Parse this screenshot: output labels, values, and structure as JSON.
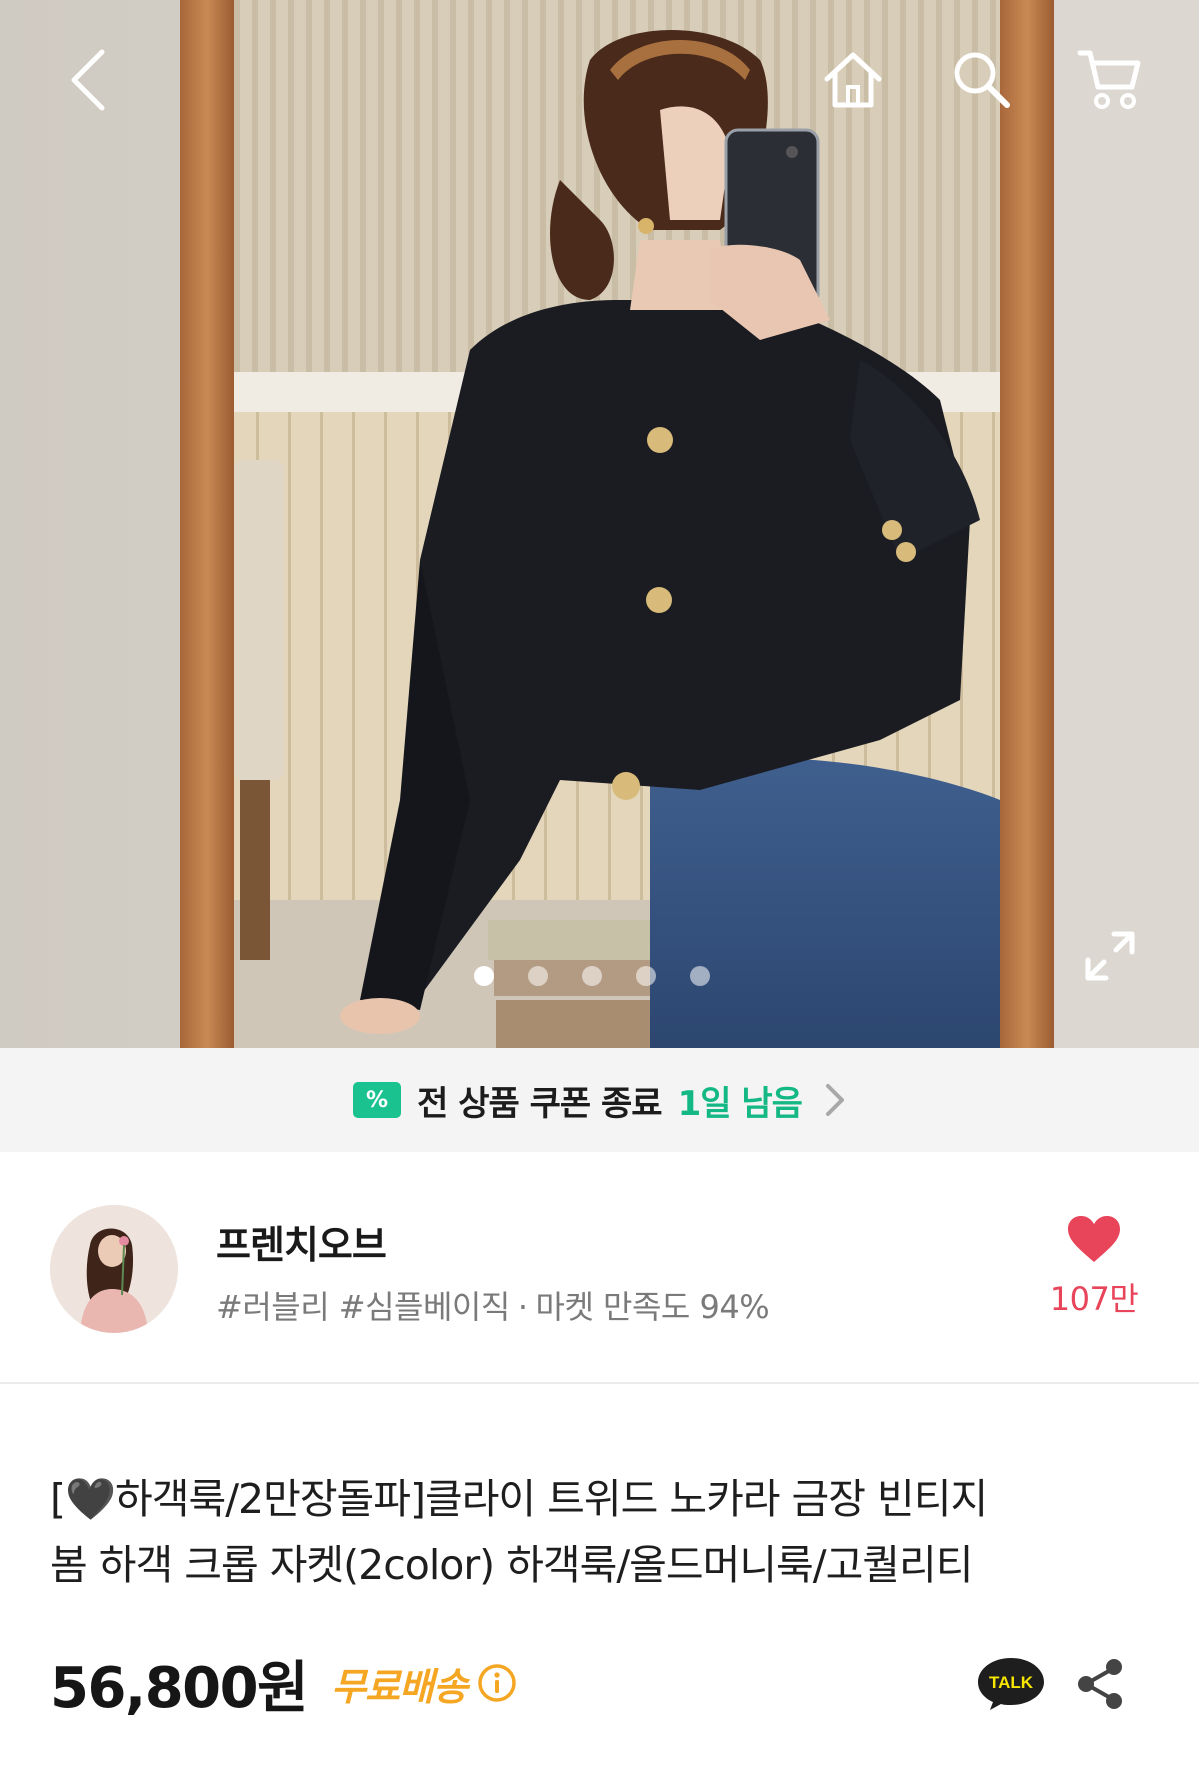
{
  "top_nav": {
    "back_icon": "chevron-left-icon",
    "home_icon": "home-icon",
    "search_icon": "search-icon",
    "cart_icon": "cart-icon",
    "expand_icon": "expand-icon"
  },
  "carousel": {
    "total": 5,
    "active_index": 0
  },
  "coupon": {
    "text": "전 상품 쿠폰 종료",
    "remaining": "1일 남음",
    "badge": "%"
  },
  "shop": {
    "name": "프렌치오브",
    "tags": "#러블리 #심플베이직",
    "separator": "·",
    "satisfaction": "마켓 만족도 94%",
    "like_count": "107만"
  },
  "product": {
    "title": "[🖤하객룩/2만장돌파]클라이 트위드 노카라 금장 빈티지\n봄 하객 크롭 자켓(2color) 하객룩/올드머니룩/고퀄리티",
    "price": "56,800원",
    "shipping": "무료배송",
    "talk_label": "TALK"
  },
  "colors": {
    "accent_green": "#14b884",
    "like_red": "#e8445a",
    "shipping_orange": "#f5a623"
  }
}
